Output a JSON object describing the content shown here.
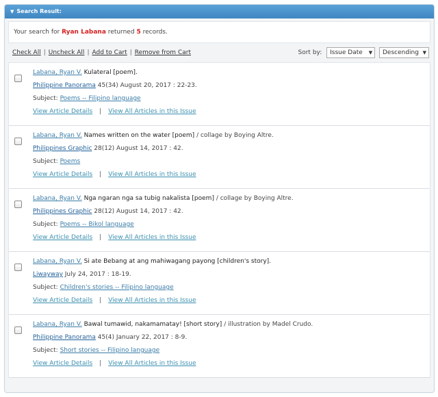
{
  "header": {
    "title": "Search Result:"
  },
  "summary": {
    "prefix": "Your search for",
    "query": "Ryan Labana",
    "mid": "returned",
    "count": "5",
    "suffix": "records."
  },
  "toolbar": {
    "check_all": "Check All",
    "uncheck_all": "Uncheck All",
    "add_to_cart": "Add to Cart",
    "remove_from_cart": "Remove from Cart",
    "sort_by_label": "Sort by:",
    "sort_field": "Issue Date",
    "sort_order": "Descending"
  },
  "subject_label": "Subject:",
  "records": [
    {
      "author": "Labana, Ryan V.",
      "title": "Kulateral [poem].",
      "extra": "",
      "publication": "Philippine Panorama",
      "citation": " 45(34) August 20, 2017 : 22-23.",
      "subject": "Poems -- Filipino language",
      "view_details": "View Article Details",
      "view_issue": "View All Articles in this Issue"
    },
    {
      "author": "Labana, Ryan V.",
      "title": "Names written on the water [poem]",
      "extra": "/ collage by Boying Altre.",
      "publication": "Philippines Graphic",
      "citation": " 28(12) August 14, 2017 : 42.",
      "subject": "Poems",
      "view_details": "View Article Details",
      "view_issue": "View All Articles in this Issue"
    },
    {
      "author": "Labana, Ryan V.",
      "title": "Nga ngaran nga sa tubig nakalista [poem]",
      "extra": "/ collage by Boying Altre.",
      "publication": "Philippines Graphic",
      "citation": " 28(12) August 14, 2017 : 42.",
      "subject": "Poems -- Bikol language",
      "view_details": "View Article Details",
      "view_issue": "View All Articles in this Issue"
    },
    {
      "author": "Labana, Ryan V.",
      "title": "Si ate Bebang at ang mahiwagang payong [children's story].",
      "extra": "",
      "publication": "Liwayway",
      "citation": " July 24, 2017 : 18-19.",
      "subject": "Children's stories -- Filipino language",
      "view_details": "View Article Details",
      "view_issue": "View All Articles in this Issue"
    },
    {
      "author": "Labana, Ryan V.",
      "title": "Bawal tumawid, nakamamatay! [short story]",
      "extra": "/ illustration by Madel Crudo.",
      "publication": "Philippine Panorama",
      "citation": " 45(4) January 22, 2017 : 8-9.",
      "subject": "Short stories -- Filipino language",
      "view_details": "View Article Details",
      "view_issue": "View All Articles in this Issue"
    }
  ]
}
